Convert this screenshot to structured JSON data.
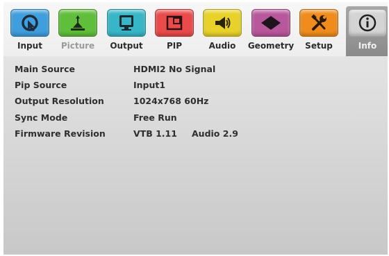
{
  "menu": {
    "tabs": [
      {
        "label": "Input",
        "icon": "input-icon",
        "color": "#3f9edd"
      },
      {
        "label": "Picture",
        "icon": "picture-icon",
        "color": "#5fbf3a"
      },
      {
        "label": "Output",
        "icon": "output-icon",
        "color": "#37b6c7"
      },
      {
        "label": "PIP",
        "icon": "pip-icon",
        "color": "#ea4a4a"
      },
      {
        "label": "Audio",
        "icon": "audio-icon",
        "color": "#e8d22a"
      },
      {
        "label": "Geometry",
        "icon": "geometry-icon",
        "color": "#b9579c"
      },
      {
        "label": "Setup",
        "icon": "setup-icon",
        "color": "#f08c1c"
      },
      {
        "label": "Info",
        "icon": "info-icon",
        "color": "#b5b5b5"
      }
    ],
    "active_tab": "Info",
    "disabled_tab": "Picture"
  },
  "info": {
    "main_source": {
      "label": "Main Source",
      "value": "HDMI2 No Signal"
    },
    "pip_source": {
      "label": "Pip Source",
      "value": "Input1"
    },
    "output_resolution": {
      "label": "Output Resolution",
      "value": "1024x768 60Hz"
    },
    "sync_mode": {
      "label": "Sync Mode",
      "value": "Free Run"
    },
    "firmware_revision": {
      "label": "Firmware Revision",
      "value": "VTB 1.11",
      "value2": "Audio 2.9"
    }
  }
}
